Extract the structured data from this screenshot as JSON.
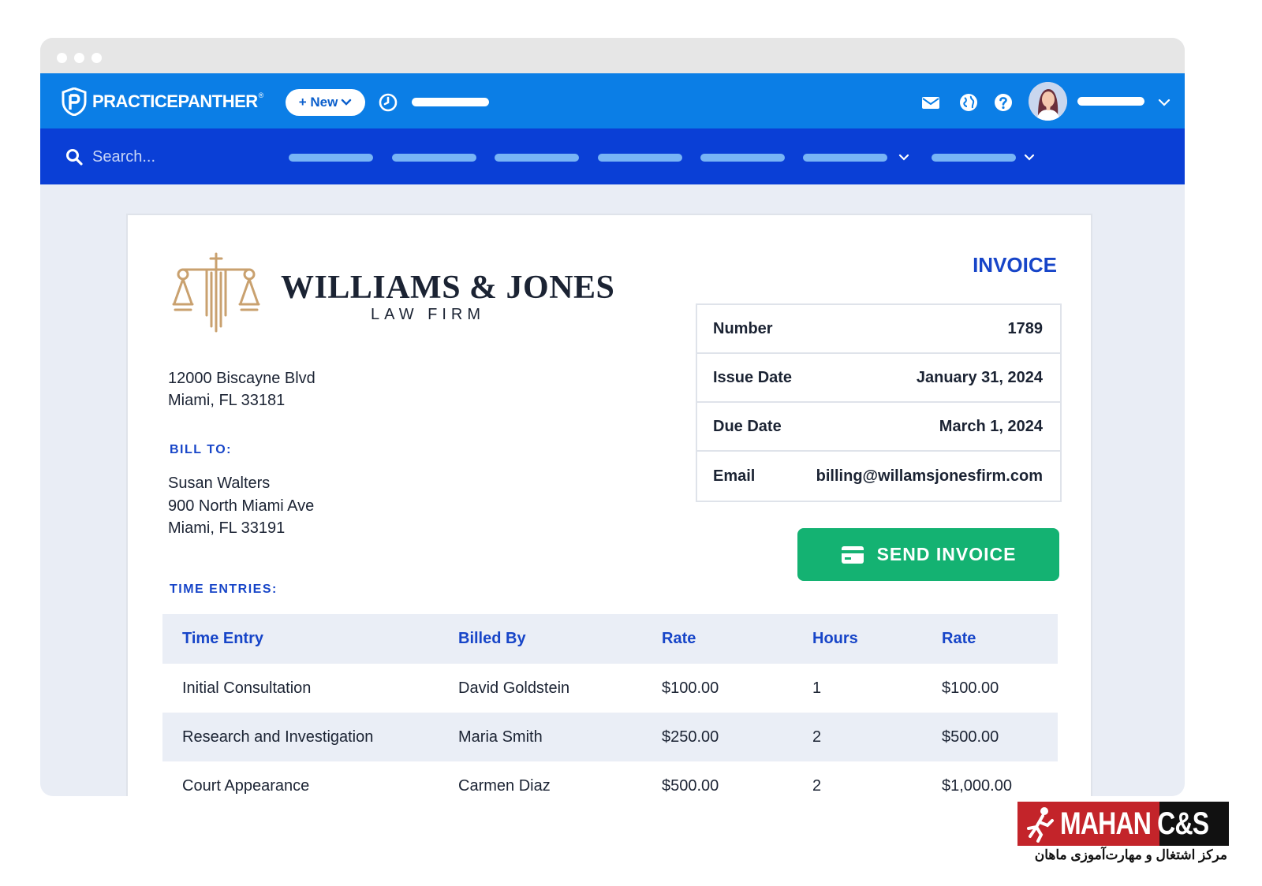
{
  "app": {
    "brand": "PRACTICEPANTHER",
    "brand_reg": "®",
    "new_button": "+ New"
  },
  "search": {
    "placeholder": "Search..."
  },
  "invoice": {
    "firm_name": "WILLIAMS & JONES",
    "firm_sub": "LAW FIRM",
    "address": [
      "12000 Biscayne Blvd",
      "Miami, FL 33181"
    ],
    "bill_to_label": "BILL TO:",
    "bill_to": [
      "Susan Walters",
      "900 North Miami Ave",
      "Miami, FL 33191"
    ],
    "title": "INVOICE",
    "meta": [
      {
        "label": "Number",
        "value": "1789"
      },
      {
        "label": "Issue Date",
        "value": "January 31, 2024"
      },
      {
        "label": "Due Date",
        "value": "March 1, 2024"
      },
      {
        "label": "Email",
        "value": "billing@willamsjonesfirm.com"
      }
    ],
    "send_button": "SEND INVOICE",
    "time_entries_label": "TIME ENTRIES:",
    "columns": [
      "Time Entry",
      "Billed By",
      "Rate",
      "Hours",
      "Rate"
    ],
    "rows": [
      [
        "Initial Consultation",
        "David Goldstein",
        "$100.00",
        "1",
        "$100.00"
      ],
      [
        "Research and Investigation",
        "Maria Smith",
        "$250.00",
        "2",
        "$500.00"
      ],
      [
        "Court Appearance",
        "Carmen Diaz",
        "$500.00",
        "2",
        "$1,000.00"
      ]
    ]
  },
  "watermark": {
    "title": "MAHAN C&S",
    "subtitle": "مرکز اشتغال و مهارت‌آموزی ماهان"
  },
  "colors": {
    "topbar": "#0b7ee6",
    "navbar": "#0a3fd6",
    "accent": "#1745c8",
    "send_button": "#14b272"
  },
  "icons": [
    "panther-logo-icon",
    "clock-icon",
    "mail-icon",
    "globe-icon",
    "help-icon",
    "search-icon",
    "chevron-down-icon",
    "credit-card-icon",
    "scales-of-justice-icon"
  ]
}
